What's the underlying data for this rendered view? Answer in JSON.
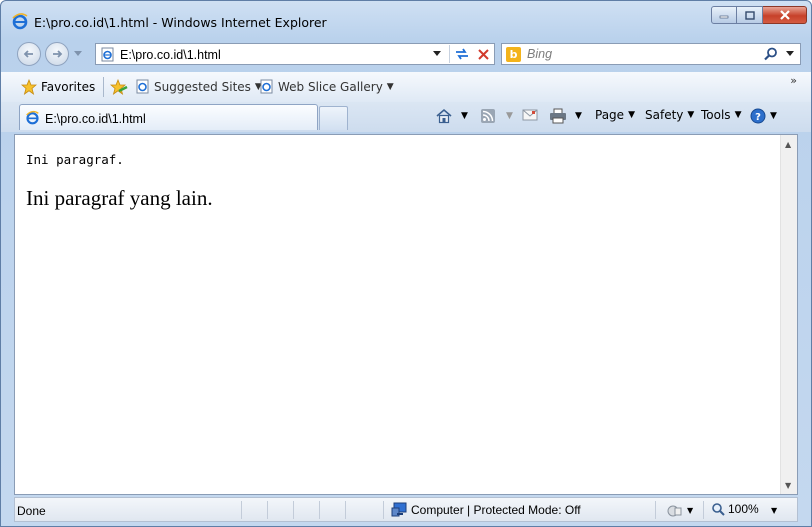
{
  "window": {
    "title": "E:\\pro.co.id\\1.html - Windows Internet Explorer"
  },
  "address_bar": {
    "url": "E:\\pro.co.id\\1.html"
  },
  "search": {
    "placeholder": "Bing"
  },
  "favorites_bar": {
    "favorites_label": "Favorites",
    "links": [
      {
        "label": "Suggested Sites"
      },
      {
        "label": "Web Slice Gallery"
      }
    ]
  },
  "tabs": [
    {
      "label": "E:\\pro.co.id\\1.html"
    }
  ],
  "command_bar": {
    "page_label": "Page",
    "safety_label": "Safety",
    "tools_label": "Tools"
  },
  "content": {
    "paragraph_1": "Ini paragraf.",
    "paragraph_2": "Ini paragraf yang lain."
  },
  "status_bar": {
    "status": "Done",
    "zone": "Computer | Protected Mode: Off",
    "zoom": "100%"
  },
  "colors": {
    "frame": "#b9d1ec",
    "close_button": "#c7412a",
    "bing": "#f3b31b",
    "ie_blue": "#1e6fd6"
  }
}
